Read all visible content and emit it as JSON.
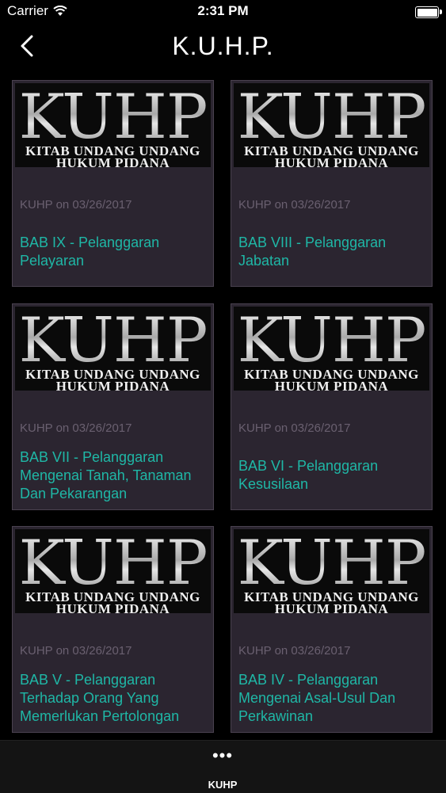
{
  "status_bar": {
    "carrier": "Carrier",
    "time": "2:31 PM",
    "battery_level": 1.0
  },
  "nav": {
    "title": "K.U.H.P.",
    "back_icon": "chevron-left-icon"
  },
  "cards": [
    {
      "banner_title": "KUHP",
      "banner_line1": "KITAB UNDANG UNDANG",
      "banner_line2": "HUKUM PIDANA",
      "meta": "KUHP on 03/26/2017",
      "title": "BAB IX - Pelanggaran Pelayaran"
    },
    {
      "banner_title": "KUHP",
      "banner_line1": "KITAB UNDANG UNDANG",
      "banner_line2": "HUKUM PIDANA",
      "meta": "KUHP on 03/26/2017",
      "title": "BAB VIII - Pelanggaran Jabatan"
    },
    {
      "banner_title": "KUHP",
      "banner_line1": "KITAB UNDANG UNDANG",
      "banner_line2": "HUKUM PIDANA",
      "meta": "KUHP on 03/26/2017",
      "title": "BAB VII - Pelanggaran Mengenai Tanah, Tanaman Dan Pekarangan"
    },
    {
      "banner_title": "KUHP",
      "banner_line1": "KITAB UNDANG UNDANG",
      "banner_line2": "HUKUM PIDANA",
      "meta": "KUHP on 03/26/2017",
      "title": "BAB VI - Pelanggaran Kesusilaan"
    },
    {
      "banner_title": "KUHP",
      "banner_line1": "KITAB UNDANG UNDANG",
      "banner_line2": "HUKUM PIDANA",
      "meta": "KUHP on 03/26/2017",
      "title": "BAB V - Pelanggaran Terhadap Orang Yang Memerlukan Pertolongan"
    },
    {
      "banner_title": "KUHP",
      "banner_line1": "KITAB UNDANG UNDANG",
      "banner_line2": "HUKUM PIDANA",
      "meta": "KUHP on 03/26/2017",
      "title": "BAB IV - Pelanggaran Mengenai Asal-Usul Dan Perkawinan"
    }
  ],
  "tab_bar": {
    "icon": "more-dots-icon",
    "label": "KUHP"
  },
  "colors": {
    "accent": "#1fb7a6",
    "card_background": "#2b2530",
    "meta_text": "#6a6070"
  }
}
